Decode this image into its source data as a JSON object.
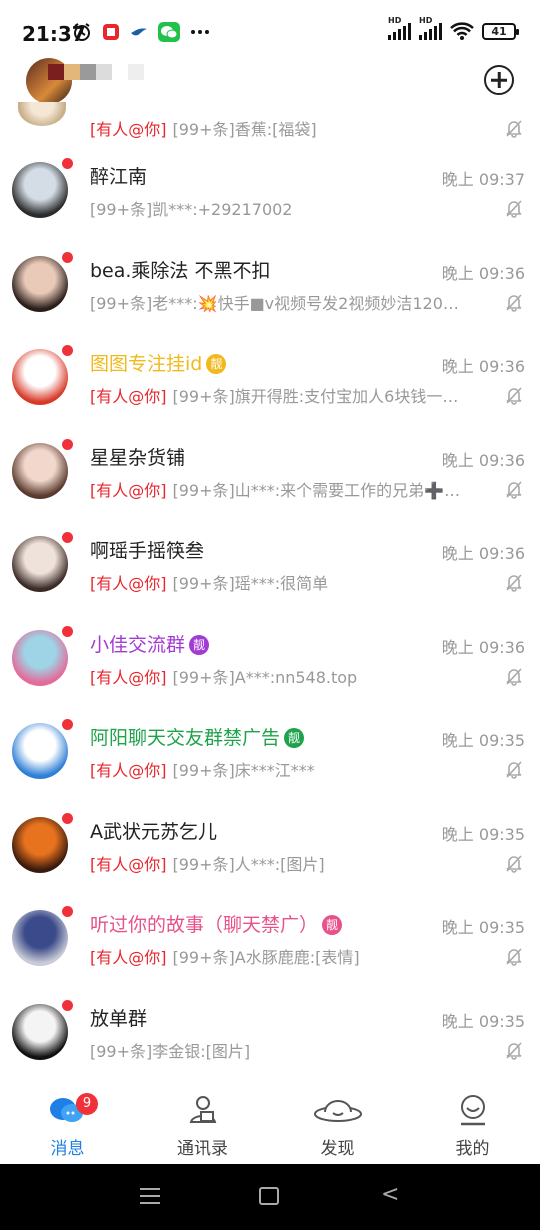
{
  "status_bar": {
    "time": "21:37",
    "battery": "41",
    "left_icons": [
      "alarm-icon",
      "app-icon",
      "bird-icon",
      "wechat-icon",
      "more-dots"
    ],
    "right_icons": [
      "signal-hd-icon",
      "signal-hd-icon",
      "wifi-icon",
      "battery-icon"
    ]
  },
  "header": {
    "add_icon": "plus-circle-icon"
  },
  "conversations": [
    {
      "name": "",
      "badge": "",
      "badge_color": "",
      "name_color": "#222222",
      "time": "",
      "mention": "[有人@你]",
      "preview": "[99+条]香蕉:[福袋]",
      "partial": true,
      "avatar_colors": [
        "#f4e7d6",
        "#c9b08a"
      ],
      "unread": false
    },
    {
      "name": "醉江南",
      "badge": "",
      "badge_color": "",
      "name_color": "#222222",
      "time": "晚上 09:37",
      "mention": "",
      "preview": "[99+条]凯***:+29217002",
      "partial": false,
      "avatar_colors": [
        "#d4dde6",
        "#2b2b2b"
      ],
      "unread": true
    },
    {
      "name": "bea.乘除法 不黑不扣",
      "badge": "",
      "badge_color": "",
      "name_color": "#222222",
      "time": "晚上 09:36",
      "mention": "",
      "preview": "[99+条]老***:💥快手■v视频号发2视频妙洁120…",
      "partial": false,
      "avatar_colors": [
        "#e9c9b8",
        "#2a1e1a"
      ],
      "unread": true
    },
    {
      "name": "图图专注挂id",
      "badge": "靓",
      "badge_color": "#f1b91b",
      "name_color": "#f1b91b",
      "time": "晚上 09:36",
      "mention": "[有人@你]",
      "preview": "[99+条]旗开得胜:支付宝加人6块钱一…",
      "partial": false,
      "avatar_colors": [
        "#ffffff",
        "#d83a2a"
      ],
      "unread": true
    },
    {
      "name": "星星杂货铺",
      "badge": "",
      "badge_color": "",
      "name_color": "#222222",
      "time": "晚上 09:36",
      "mention": "[有人@你]",
      "preview": "[99+条]山***:来个需要工作的兄弟➕…",
      "partial": false,
      "avatar_colors": [
        "#f2d8cc",
        "#5a3a2e"
      ],
      "unread": true
    },
    {
      "name": "啊瑶手摇筷叁",
      "badge": "",
      "badge_color": "",
      "name_color": "#222222",
      "time": "晚上 09:36",
      "mention": "[有人@你]",
      "preview": "[99+条]瑶***:很简单",
      "partial": false,
      "avatar_colors": [
        "#efe2da",
        "#3a2a26"
      ],
      "unread": true
    },
    {
      "name": "小佳交流群",
      "badge": "靓",
      "badge_color": "#a23bd4",
      "name_color": "#a23bd4",
      "time": "晚上 09:36",
      "mention": "[有人@你]",
      "preview": "[99+条]A***:nn548.top",
      "partial": false,
      "avatar_colors": [
        "#9fd3e6",
        "#e46a9a"
      ],
      "unread": true
    },
    {
      "name": "阿阳聊天交友群禁广告",
      "badge": "靓",
      "badge_color": "#1fa34a",
      "name_color": "#1fa34a",
      "time": "晚上 09:35",
      "mention": "[有人@你]",
      "preview": "[99+条]床***江***",
      "partial": false,
      "avatar_colors": [
        "#ffffff",
        "#2f7fd6"
      ],
      "unread": true
    },
    {
      "name": "A武状元苏乞儿",
      "badge": "",
      "badge_color": "",
      "name_color": "#222222",
      "time": "晚上 09:35",
      "mention": "[有人@你]",
      "preview": "[99+条]人***:[图片]",
      "partial": false,
      "avatar_colors": [
        "#e8731e",
        "#3a1a0c"
      ],
      "unread": true
    },
    {
      "name": "听过你的故事（聊天禁广）",
      "badge": "靓",
      "badge_color": "#e8518c",
      "name_color": "#e8518c",
      "time": "晚上 09:35",
      "mention": "[有人@你]",
      "preview": "[99+条]A水豚鹿鹿:[表情]",
      "partial": false,
      "avatar_colors": [
        "#3a4a8a",
        "#c9cbd6"
      ],
      "unread": true
    },
    {
      "name": "放单群",
      "badge": "",
      "badge_color": "",
      "name_color": "#222222",
      "time": "晚上 09:35",
      "mention": "",
      "preview": "[99+条]李金银:[图片]",
      "partial": false,
      "avatar_colors": [
        "#f4f4f4",
        "#111111"
      ],
      "unread": true
    }
  ],
  "tabbar": {
    "tabs": [
      {
        "label": "消息",
        "icon": "chat-bubbles-icon",
        "badge": "9",
        "active": true
      },
      {
        "label": "通讯录",
        "icon": "contacts-icon",
        "badge": "",
        "active": false
      },
      {
        "label": "发现",
        "icon": "planet-icon",
        "badge": "",
        "active": false
      },
      {
        "label": "我的",
        "icon": "profile-smile-icon",
        "badge": "",
        "active": false
      }
    ]
  },
  "colors": {
    "accent": "#1e7fe6",
    "mention": "#e8262e",
    "unread_dot": "#f0313a",
    "muted_text": "#999999"
  }
}
